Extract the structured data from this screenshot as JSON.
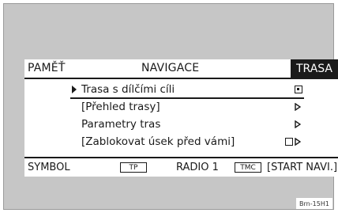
{
  "header": {
    "left_tab": "PAMĚŤ",
    "title": "NAVIGACE",
    "right_tab": "TRASA"
  },
  "menu": {
    "items": [
      {
        "label": "Trasa s dílčími cíli",
        "indicator": "selected-box-icon",
        "selected": true
      },
      {
        "label": "[Přehled trasy]",
        "indicator": "outline-arrow-icon",
        "selected": false
      },
      {
        "label": "Parametry tras",
        "indicator": "outline-arrow-icon",
        "selected": false
      },
      {
        "label": "[Zablokovat úsek před vámi]",
        "indicator": "checkbox-arrow-icon",
        "selected": false
      }
    ]
  },
  "footer": {
    "symbol": "SYMBOL",
    "tp_badge": "TP",
    "radio": "RADIO 1",
    "tmc_badge": "TMC",
    "start_navi": "[START NAVI.]"
  },
  "image_tag": "Brn-15H1"
}
